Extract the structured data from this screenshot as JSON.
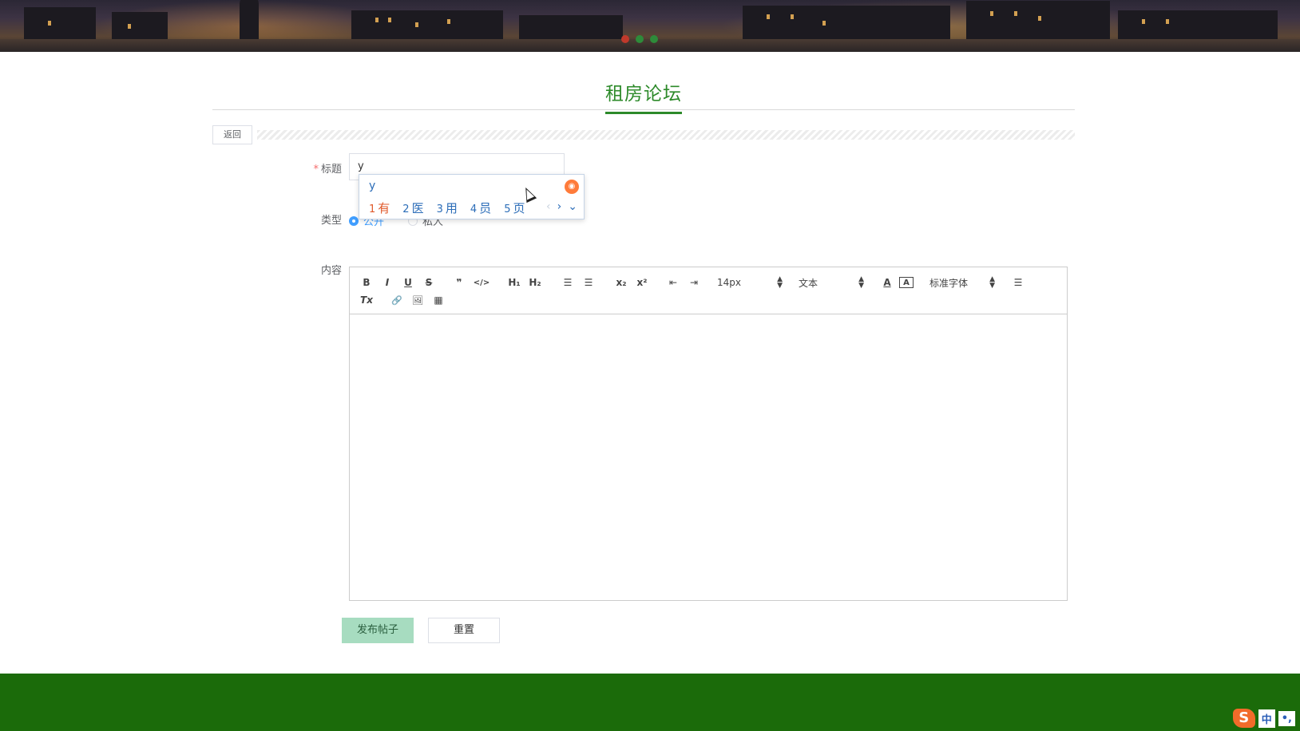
{
  "banner": {
    "carousel_dot_colors": [
      "#c0392b",
      "#2e8b3a",
      "#2e8b3a"
    ]
  },
  "page": {
    "title": "租房论坛",
    "accent_color": "#2d8a2a"
  },
  "back_button": {
    "label": "返回"
  },
  "form": {
    "title_label": "标题",
    "title_value": "y",
    "type_label": "类型",
    "type_options": [
      {
        "label": "公开",
        "selected": true
      },
      {
        "label": "私人",
        "selected": false
      }
    ],
    "content_label": "内容"
  },
  "ime": {
    "composition": "y",
    "candidates": [
      {
        "num": "1",
        "text": "有"
      },
      {
        "num": "2",
        "text": "医"
      },
      {
        "num": "3",
        "text": "用"
      },
      {
        "num": "4",
        "text": "员"
      },
      {
        "num": "5",
        "text": "页"
      }
    ]
  },
  "editor": {
    "toolbar": {
      "bold": "B",
      "italic": "I",
      "underline": "U",
      "strike": "S",
      "quote": "❞",
      "code": "</>",
      "h1": "H₁",
      "h2": "H₂",
      "ordered_list": "☰",
      "bullet_list": "☰",
      "subscript": "x₂",
      "superscript": "x²",
      "outdent": "⇤",
      "indent": "⇥",
      "size": "14px",
      "header": "文本",
      "color": "A",
      "background": "A",
      "font": "标准字体",
      "align": "☰",
      "clean": "Tx",
      "link": "🔗",
      "image": "🖼",
      "video": "▦"
    }
  },
  "buttons": {
    "publish": "发布帖子",
    "reset": "重置"
  },
  "taskbar": {
    "ime_logo": "S",
    "ime_mode": "中",
    "ime_punct": "•,"
  }
}
